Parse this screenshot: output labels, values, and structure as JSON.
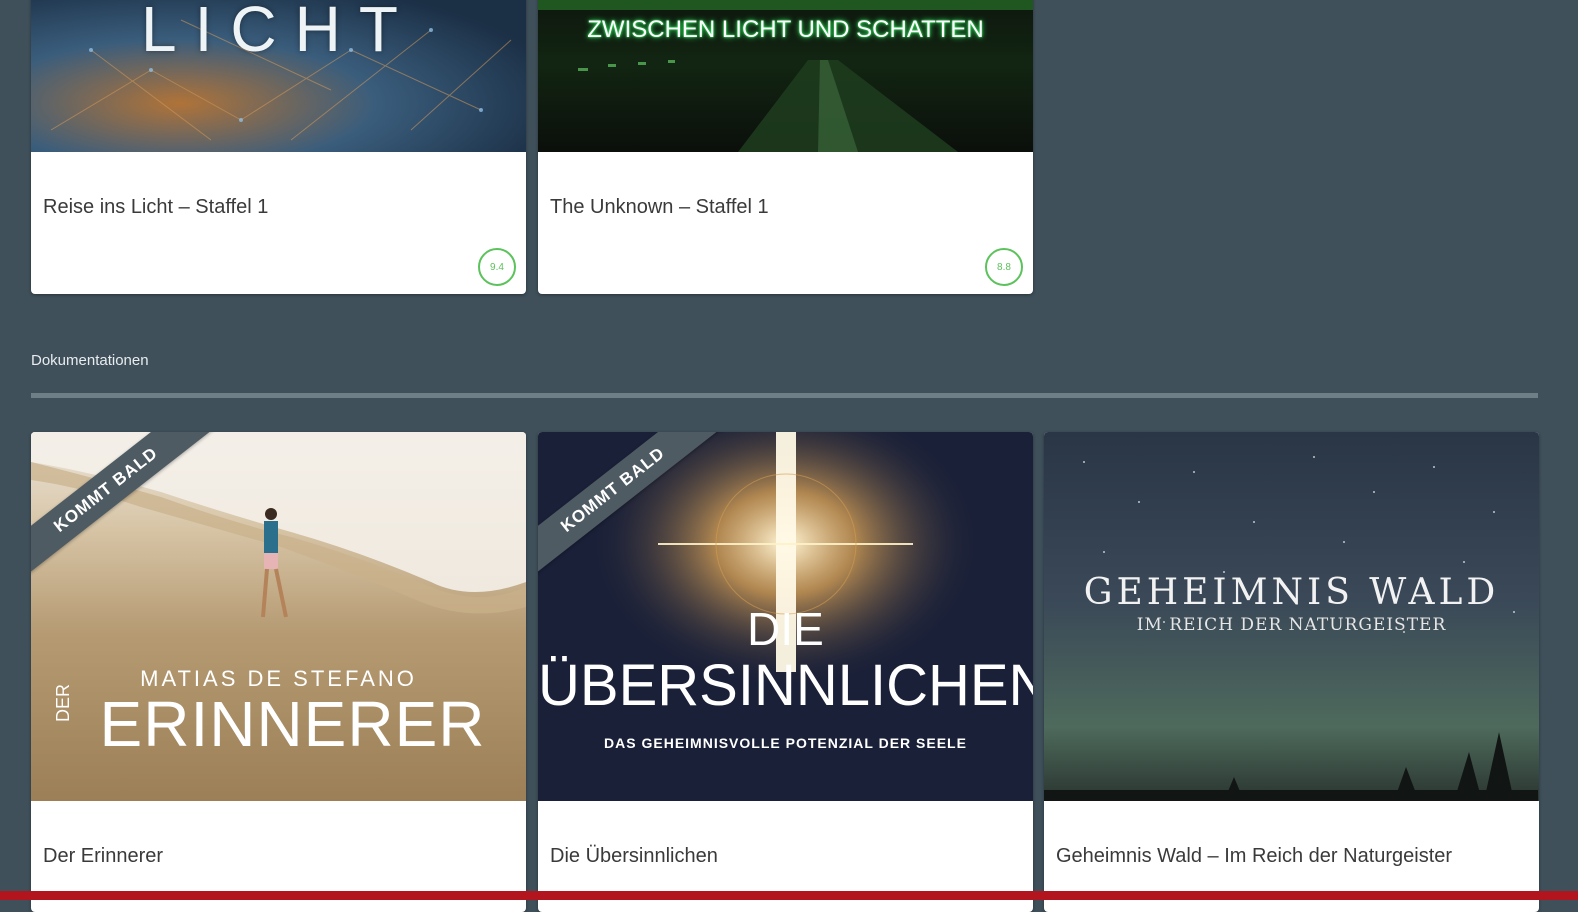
{
  "top_row": {
    "cards": [
      {
        "poster_text": "LICHT",
        "title": "Reise ins Licht – Staffel 1",
        "rating": "9.4"
      },
      {
        "poster_text": "ZWISCHEN LICHT UND SCHATTEN",
        "title": "The Unknown – Staffel 1",
        "rating": "8.8"
      }
    ]
  },
  "section": {
    "title": "Dokumentationen"
  },
  "doc_row": {
    "cards": [
      {
        "ribbon": "KOMMT BALD",
        "poster_author": "MATIAS DE STEFANO",
        "poster_der": "DER",
        "poster_title": "ERINNERER",
        "title": "Der Erinnerer"
      },
      {
        "ribbon": "KOMMT BALD",
        "poster_line1": "DIE",
        "poster_line2": "ÜBERSINNLICHEN",
        "poster_sub": "DAS GEHEIMNISVOLLE POTENZIAL DER SEELE",
        "title": "Die Übersinnlichen"
      },
      {
        "poster_title": "GEHEIMNIS WALD",
        "poster_sub": "IM REICH DER NATURGEISTER",
        "title": "Geheimnis Wald – Im Reich der Naturgeister"
      }
    ]
  },
  "colors": {
    "background": "#3f505a",
    "rating_green": "#5cc25c",
    "bottom_bar": "#b3151e",
    "neon_green": "#39ff6a"
  },
  "icons": {
    "rating": "rating-circle-icon"
  }
}
